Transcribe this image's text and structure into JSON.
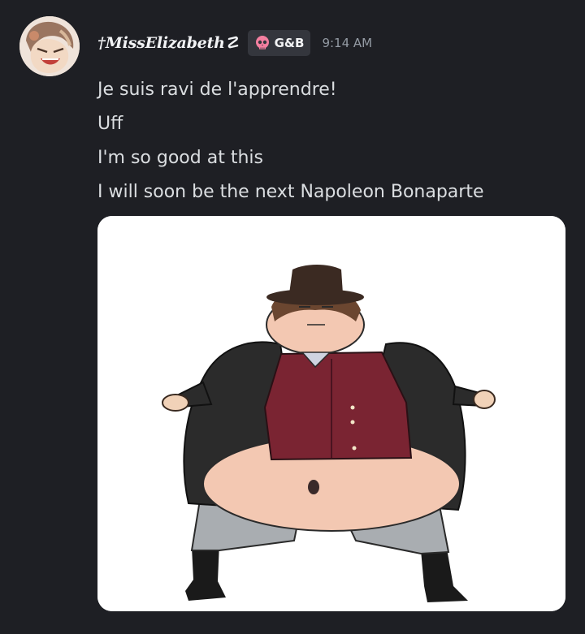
{
  "message": {
    "username": "†MissElizabeth☡",
    "role_tag": {
      "icon": "pink-skull-icon",
      "label": "G&B",
      "color": "#f47fa0"
    },
    "timestamp": "9:14 AM",
    "lines": [
      "Je suis ravi de l'apprendre!",
      "Uff",
      "I'm so good at this",
      "I will soon be the next Napoleon Bonaparte"
    ],
    "attachment": {
      "kind": "drawing",
      "background": "#ffffff"
    }
  },
  "theme": {
    "background": "#1e1f24",
    "text": "#dbdee1",
    "muted": "#949ba4",
    "tag_bg": "#34363d"
  }
}
